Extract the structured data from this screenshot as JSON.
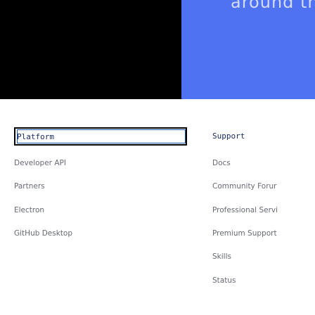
{
  "hero": {
    "heading": "around the com"
  },
  "footer": {
    "platform": {
      "title": "Platform",
      "links": [
        "Developer API",
        "Partners",
        "Electron",
        "GitHub Desktop"
      ]
    },
    "support": {
      "title": "Support",
      "links": [
        "Docs",
        "Community Forur",
        "Professional Servi",
        "Premium Support",
        "Skills",
        "Status"
      ]
    }
  },
  "colors": {
    "hero_left": "#000000",
    "hero_right": "#4f72f2",
    "link": "#666a73",
    "header_text": "#1c2b63",
    "focus_outline": "#1c4fa8"
  }
}
